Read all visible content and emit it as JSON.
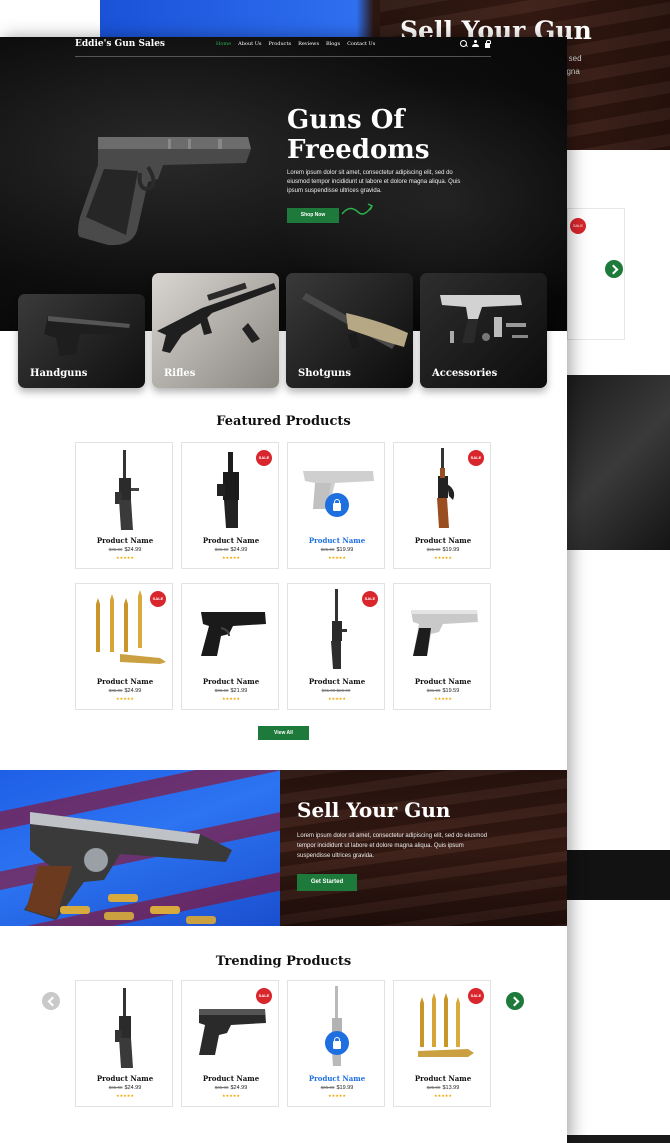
{
  "background_page": {
    "hero_title": "Sell Your Gun",
    "hero_text": "t, sed\nagna",
    "sale_badge": "SALE"
  },
  "nav": {
    "logo": "Eddie's Gun Sales",
    "menu": [
      "Home",
      "About Us",
      "Products",
      "Reviews",
      "Blogs",
      "Contact Us"
    ],
    "active": "Home",
    "icons": [
      "search-icon",
      "user-icon",
      "cart-icon"
    ]
  },
  "hero": {
    "title": "Guns Of Freedoms",
    "text": "Lorem ipsum dolor sit amet, consectetur adipiscing elit, sed do eiusmod tempor incididunt ut labore et dolore magna aliqua. Quis ipsum suspendisse ultrices gravida.",
    "button": "Shop Now"
  },
  "categories": [
    "Handguns",
    "Rifles",
    "Shotguns",
    "Accessories"
  ],
  "featured": {
    "title": "Featured Products",
    "products": [
      {
        "name": "Product Name",
        "old_price": "$35.00",
        "price": "$24.99",
        "sale": false
      },
      {
        "name": "Product Name",
        "old_price": "$35.00",
        "price": "$24.99",
        "sale": true
      },
      {
        "name": "Product Name",
        "old_price": "$25.00",
        "price": "$19.99",
        "sale": false
      },
      {
        "name": "Product Name",
        "old_price": "$25.00",
        "price": "$19.99",
        "sale": true
      },
      {
        "name": "Product Name",
        "old_price": "$35.00",
        "price": "$24.99",
        "sale": true
      },
      {
        "name": "Product Name",
        "old_price": "$35.00",
        "price": "$21.99",
        "sale": false
      },
      {
        "name": "Product Name",
        "old_price": "$31.99 $25.00",
        "price": "",
        "sale": true
      },
      {
        "name": "Product Name",
        "old_price": "$31.99",
        "price": "$19.59",
        "sale": false
      }
    ],
    "sale_badge": "SALE",
    "stars": "★★★★★",
    "view_all": "View All"
  },
  "sell": {
    "title": "Sell Your Gun",
    "text": "Lorem ipsum dolor sit amet, consectetur adipiscing elit, sed do eiusmod tempor incididunt ut labore et dolore magna aliqua. Quis ipsum suspendisse ultrices gravida.",
    "button": "Get Started"
  },
  "trending": {
    "title": "Trending Products",
    "products": [
      {
        "name": "Product Name",
        "old_price": "$35.00",
        "price": "$24.99",
        "sale": false
      },
      {
        "name": "Product Name",
        "old_price": "$35.00",
        "price": "$24.99",
        "sale": true
      },
      {
        "name": "Product Name",
        "old_price": "$25.00",
        "price": "$19.99",
        "sale": false
      },
      {
        "name": "Product Name",
        "old_price": "$25.00",
        "price": "$13.99",
        "sale": true
      }
    ]
  },
  "colors": {
    "accent_green": "#1d7a3a",
    "sale_red": "#d8262c",
    "link_blue": "#1e6fe0",
    "star_gold": "#f0a500"
  }
}
